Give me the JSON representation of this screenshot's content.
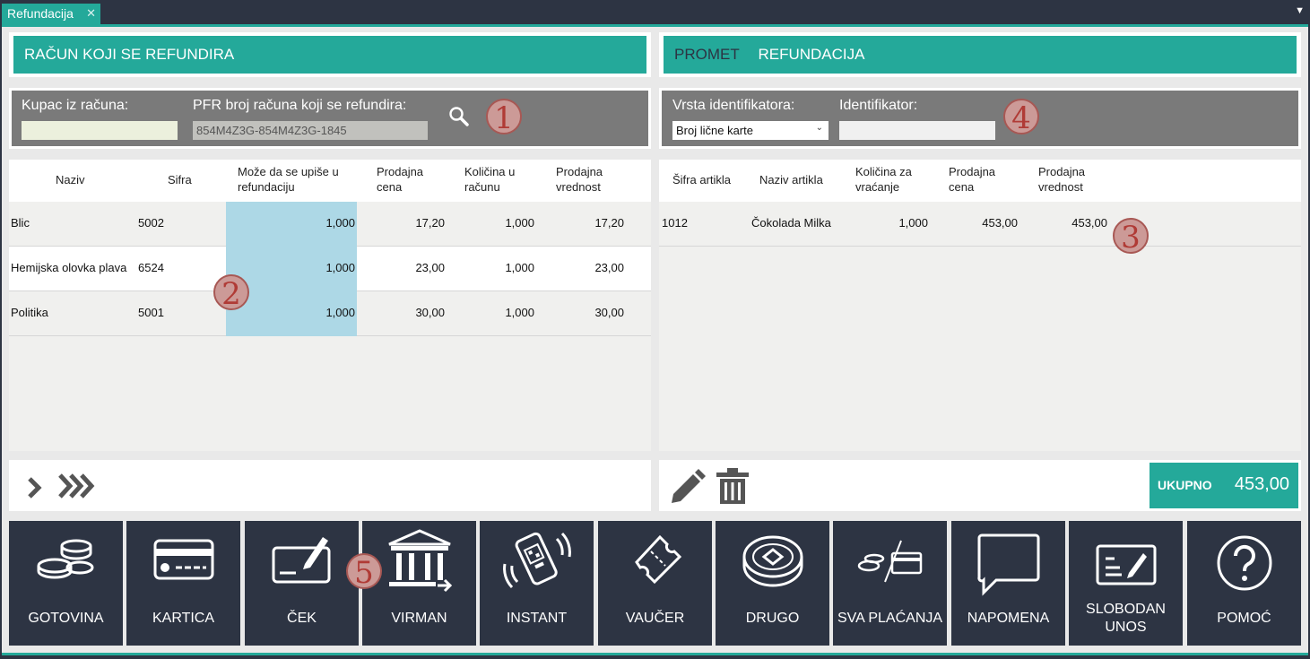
{
  "tab": {
    "title": "Refundacija",
    "close": "✕"
  },
  "left": {
    "header": "RAČUN KOJI SE REFUNDIRA",
    "customer_label": "Kupac iz računa:",
    "customer_value": "",
    "pfr_label": "PFR broj računa koji se refundira:",
    "pfr_value": "854M4Z3G-854M4Z3G-1845",
    "marker": "1",
    "table_marker": "2",
    "columns": [
      "Naziv",
      "Sifra",
      "Može da se upiše u refundaciju",
      "Prodajna cena",
      "Količina u računu",
      "Prodajna vrednost"
    ],
    "rows": [
      {
        "naziv": "Blic",
        "sifra": "5002",
        "upis": "1,000",
        "cena": "17,20",
        "kolicina": "1,000",
        "vrednost": "17,20"
      },
      {
        "naziv": "Hemijska olovka plava",
        "sifra": "6524",
        "upis": "1,000",
        "cena": "23,00",
        "kolicina": "1,000",
        "vrednost": "23,00"
      },
      {
        "naziv": "Politika",
        "sifra": "5001",
        "upis": "1,000",
        "cena": "30,00",
        "kolicina": "1,000",
        "vrednost": "30,00"
      }
    ]
  },
  "right": {
    "header_dim": "PROMET",
    "header": "REFUNDACIJA",
    "id_type_label": "Vrsta identifikatora:",
    "id_type_value": "Broj lične karte",
    "id_label": "Identifikator:",
    "id_value": "",
    "marker": "4",
    "table_marker": "3",
    "columns": [
      "Šifra artikla",
      "Naziv artikla",
      "Količina za vraćanje",
      "Prodajna cena",
      "Prodajna vrednost"
    ],
    "rows": [
      {
        "sifra": "1012",
        "naziv": "Čokolada Milka",
        "kolicina": "1,000",
        "cena": "453,00",
        "vrednost": "453,00"
      }
    ],
    "total_label": "UKUPNO",
    "total_value": "453,00"
  },
  "payment": {
    "marker": "5",
    "buttons": [
      {
        "label": "GOTOVINA",
        "icon": "coins-icon"
      },
      {
        "label": "KARTICA",
        "icon": "credit-card-icon"
      },
      {
        "label": "ČEK",
        "icon": "check-icon"
      },
      {
        "label": "VIRMAN",
        "icon": "bank-icon"
      },
      {
        "label": "INSTANT",
        "icon": "qr-phone-icon"
      },
      {
        "label": "VAUČER",
        "icon": "ticket-icon"
      },
      {
        "label": "DRUGO",
        "icon": "token-icon"
      },
      {
        "label": "SVA PLAĆANJA",
        "icon": "all-payments-icon"
      },
      {
        "label": "NAPOMENA",
        "icon": "speech-bubble-icon"
      },
      {
        "label": "SLOBODAN UNOS",
        "icon": "free-entry-icon"
      },
      {
        "label": "POMOĆ",
        "icon": "help-icon"
      }
    ]
  },
  "colors": {
    "accent": "#24a99a",
    "dark": "#2d3443",
    "highlight": "#add8e6",
    "marker": "#cc9a97"
  }
}
